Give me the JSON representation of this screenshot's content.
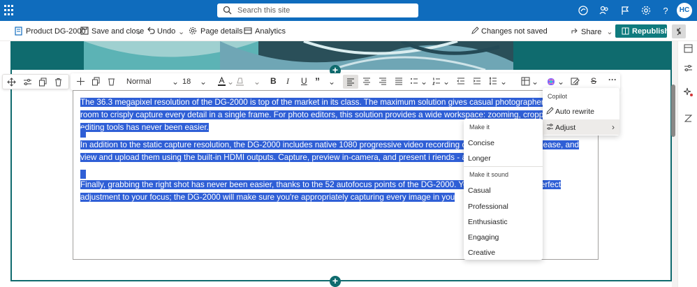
{
  "topbar": {
    "search_placeholder": "Search this site",
    "avatar_initials": "HC",
    "icons": [
      "app-launcher-icon",
      "sharepoint-icon",
      "people-icon",
      "flag-icon",
      "gear-icon",
      "help-icon"
    ]
  },
  "command_bar": {
    "page_name": "Product DG-2000",
    "save_close": "Save and close",
    "undo": "Undo",
    "page_details": "Page details",
    "analytics": "Analytics",
    "status": "Changes not saved",
    "share": "Share",
    "republish": "Republish"
  },
  "toolbar": {
    "style": "Normal",
    "font_size": "18"
  },
  "content": {
    "paragraphs": [
      "The 36.3 megapixel resolution of the DG-2000 is top of the market in its class. The maximum solution gives casual photographers and p of room to crisply capture every detail in a single frame. For photo editors, this solution provides a wide workspace: zooming, cropping, with photo editing tools has never been easier.",
      "In addition to the static capture resolution, the DG-2000 includes native 1080 progressive video recording capab HD videos with ease, and view and upload them using the built-in HDMI outputs. Capture, preview in-camera, and present i riends - all in minutes.",
      "Finally, grabbing the right shot has never been easier, thanks to the 52 autofocus points of the DG-2000. You'll n ut getting the perfect adjustment to your focus; the DG-2000 will make sure you're appropriately capturing every image in you"
    ]
  },
  "copilot_menu": {
    "header": "Copilot",
    "items": [
      "Auto rewrite",
      "Adjust"
    ]
  },
  "adjust_menu": {
    "section1": "Make it",
    "length_items": [
      "Concise",
      "Longer"
    ],
    "section2": "Make it sound",
    "tone_items": [
      "Casual",
      "Professional",
      "Enthusiastic",
      "Engaging",
      "Creative"
    ]
  },
  "colors": {
    "suite_bar": "#0f6cbd",
    "accent": "#0f6b6e",
    "selection": "#2f5fd6"
  }
}
